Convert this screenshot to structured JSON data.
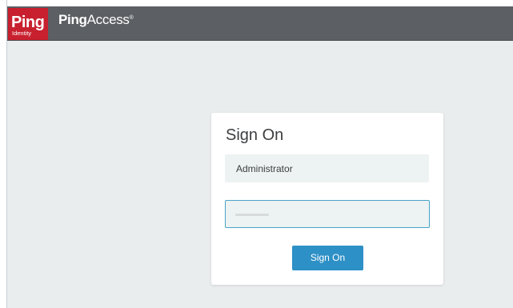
{
  "header": {
    "logo_word": "Ping",
    "logo_sub": "Identity",
    "product_bold": "Ping",
    "product_rest": "Access",
    "product_mark": "®"
  },
  "login": {
    "title": "Sign On",
    "username_value": "Administrator",
    "password_masked": true,
    "button_label": "Sign On"
  },
  "colors": {
    "header_bg": "#5c5f63",
    "logo_red": "#c8202f",
    "page_bg": "#e9edee",
    "button_blue": "#2d90c6",
    "field_bg": "#edf2f2",
    "focus_border": "#48a3c7"
  }
}
